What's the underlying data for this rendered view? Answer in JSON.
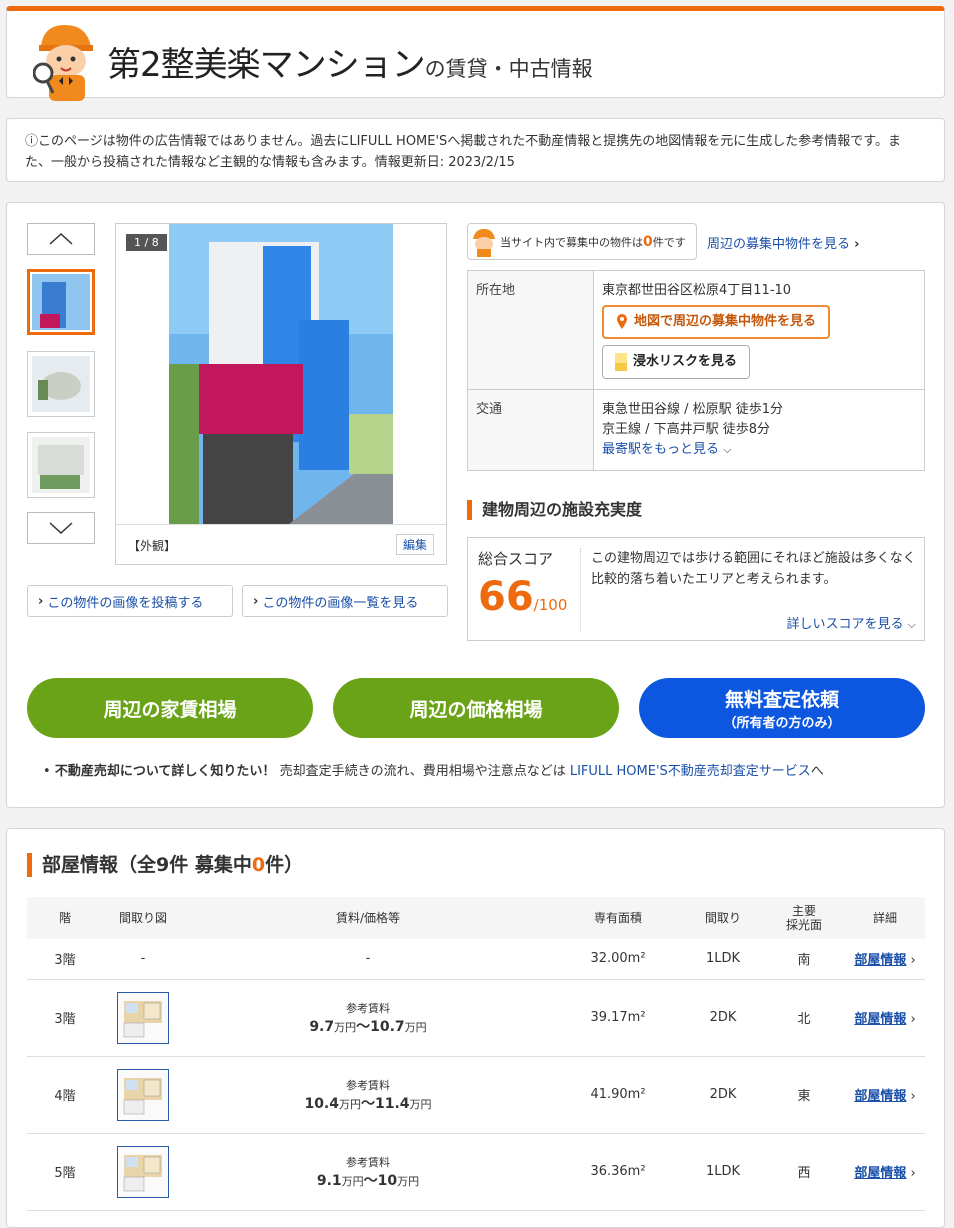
{
  "header": {
    "title": "第2整美楽マンション",
    "title_suffix": "の賃貸・中古情報"
  },
  "notice": {
    "text": "ⓘこのページは物件の広告情報ではありません。過去にLIFULL HOME'Sへ掲載された不動産情報と提携先の地図情報を元に生成した参考情報です。また、一般から投稿された情報など主観的な情報も含みます。情報更新日: 2023/2/15"
  },
  "gallery": {
    "counter": "1 / 8",
    "caption": "【外観】",
    "edit_label": "編集",
    "post_link": "この物件の画像を投稿する",
    "list_link": "この物件の画像一覧を見る"
  },
  "badge": {
    "prefix": "当サイト内で募集中の物件は",
    "count": "0",
    "suffix": "件です"
  },
  "nearby_link": "周辺の募集中物件を見る",
  "info": {
    "address_label": "所在地",
    "address": "東京都世田谷区松原4丁目11-10",
    "map_button": "地図で周辺の募集中物件を見る",
    "flood_button": "浸水リスクを見る",
    "transit_label": "交通",
    "transit_1": "東急世田谷線 / 松原駅 徒歩1分",
    "transit_2": "京王線 / 下高井戸駅 徒歩8分",
    "more_stations": "最寄駅をもっと見る"
  },
  "facility": {
    "heading": "建物周辺の施設充実度",
    "score_label": "総合スコア",
    "score": "66",
    "score_max": "/100",
    "description": "この建物周辺では歩ける範囲にそれほど施設は多くなく比較的落ち着いたエリアと考えられます。",
    "detail_link": "詳しいスコアを見る"
  },
  "buttons": {
    "rent": "周辺の家賃相場",
    "price": "周辺の価格相場",
    "assess": "無料査定依頼",
    "assess_sub": "（所有者の方のみ）"
  },
  "sell": {
    "bold": "不動産売却について詳しく知りたい！",
    "text": " 売却査定手続きの流れ、費用相場や注意点などは ",
    "link": "LIFULL HOME'S不動産売却査定サービス",
    "tail": "へ"
  },
  "rooms": {
    "heading_prefix": "部屋情報（全9件 募集中",
    "heading_count": "0",
    "heading_suffix": "件）",
    "columns": [
      "階",
      "間取り図",
      "賃料/価格等",
      "専有面積",
      "間取り",
      "主要\n採光面",
      "詳細"
    ],
    "rows": [
      {
        "floor": "3階",
        "plan": "-",
        "price_label": "",
        "price": "-",
        "area": "32.00m²",
        "layout": "1LDK",
        "dir": "南",
        "link": "部屋情報"
      },
      {
        "floor": "3階",
        "plan": "img",
        "price_label": "参考賃料",
        "price_a": "9.7",
        "price_b": "10.7",
        "area": "39.17m²",
        "layout": "2DK",
        "dir": "北",
        "link": "部屋情報"
      },
      {
        "floor": "4階",
        "plan": "img",
        "price_label": "参考賃料",
        "price_a": "10.4",
        "price_b": "11.4",
        "area": "41.90m²",
        "layout": "2DK",
        "dir": "東",
        "link": "部屋情報"
      },
      {
        "floor": "5階",
        "plan": "img",
        "price_label": "参考賃料",
        "price_a": "9.1",
        "price_b": "10",
        "area": "36.36m²",
        "layout": "1LDK",
        "dir": "西",
        "link": "部屋情報"
      }
    ],
    "unit": "万円",
    "sep": "～"
  }
}
